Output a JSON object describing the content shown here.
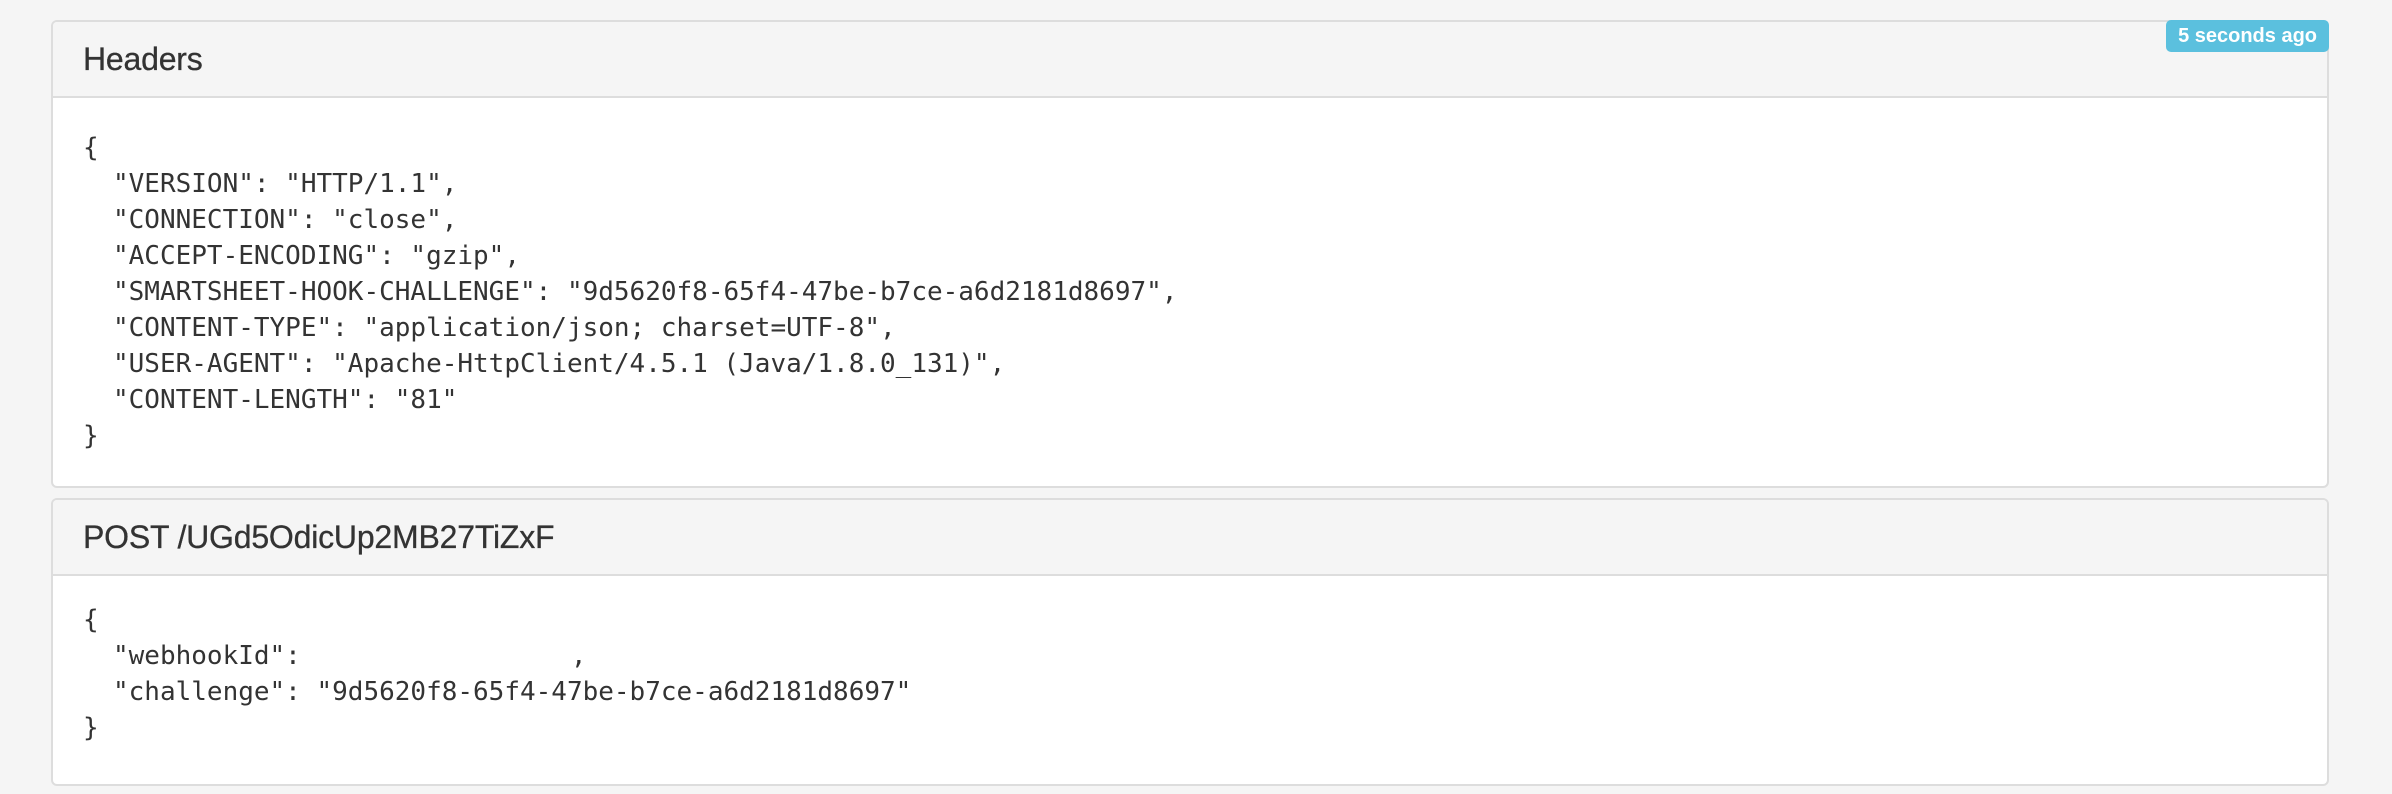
{
  "timestamp_badge": "5 seconds ago",
  "headers_panel": {
    "title": "Headers",
    "open_brace": "{",
    "lines": [
      "\"VERSION\": \"HTTP/1.1\",",
      "\"CONNECTION\": \"close\",",
      "\"ACCEPT-ENCODING\": \"gzip\",",
      "\"SMARTSHEET-HOOK-CHALLENGE\": \"9d5620f8-65f4-47be-b7ce-a6d2181d8697\",",
      "\"CONTENT-TYPE\": \"application/json; charset=UTF-8\",",
      "\"USER-AGENT\": \"Apache-HttpClient/4.5.1 (Java/1.8.0_131)\",",
      "\"CONTENT-LENGTH\": \"81\""
    ],
    "close_brace": "}"
  },
  "body_panel": {
    "title": "POST /UGd5OdicUp2MB27TiZxF",
    "open_brace": "{",
    "webhook_key": "\"webhookId\":",
    "webhook_value_tail": ",",
    "challenge_line": "\"challenge\": \"9d5620f8-65f4-47be-b7ce-a6d2181d8697\"",
    "close_brace": "}"
  }
}
